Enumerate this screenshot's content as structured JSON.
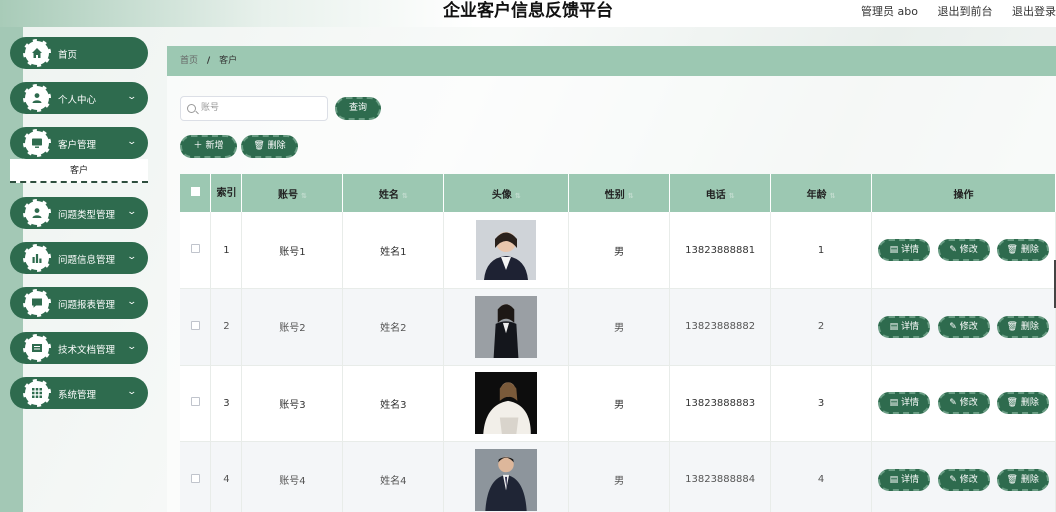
{
  "header": {
    "title": "企业客户信息反馈平台",
    "user_info": "管理员 abo",
    "exit_backend": "退出到前台",
    "logout": "退出登录"
  },
  "sidebar": {
    "items": [
      {
        "label": "首页",
        "icon": "home-icon",
        "has_arrow": false
      },
      {
        "label": "个人中心",
        "icon": "user-icon",
        "has_arrow": true
      },
      {
        "label": "客户管理",
        "icon": "monitor-icon",
        "has_arrow": true
      },
      {
        "label": "问题类型管理",
        "icon": "user-icon",
        "has_arrow": true
      },
      {
        "label": "问题信息管理",
        "icon": "chart-icon",
        "has_arrow": true
      },
      {
        "label": "问题报表管理",
        "icon": "chat-icon",
        "has_arrow": true
      },
      {
        "label": "技术文档管理",
        "icon": "doc-icon",
        "has_arrow": true
      },
      {
        "label": "系统管理",
        "icon": "grid-icon",
        "has_arrow": true
      }
    ],
    "submenu": {
      "label": "客户"
    }
  },
  "breadcrumb": {
    "home": "首页",
    "separator": "/",
    "current": "客户"
  },
  "search": {
    "placeholder": "账号",
    "button": "查询"
  },
  "actions": {
    "add": "新增",
    "delete": "删除"
  },
  "table": {
    "headers": [
      "索引",
      "账号",
      "姓名",
      "头像",
      "性别",
      "电话",
      "年龄",
      "操作"
    ],
    "rows": [
      {
        "index": "1",
        "account": "账号1",
        "name": "姓名1",
        "gender": "男",
        "phone": "13823888881",
        "age": "1"
      },
      {
        "index": "2",
        "account": "账号2",
        "name": "姓名2",
        "gender": "男",
        "phone": "13823888882",
        "age": "2"
      },
      {
        "index": "3",
        "account": "账号3",
        "name": "姓名3",
        "gender": "男",
        "phone": "13823888883",
        "age": "3"
      },
      {
        "index": "4",
        "account": "账号4",
        "name": "姓名4",
        "gender": "男",
        "phone": "13823888884",
        "age": "4"
      }
    ],
    "row_actions": {
      "detail": "详情",
      "edit": "修改",
      "delete": "删除"
    }
  },
  "colors": {
    "primary": "#2e6b4e",
    "header_green": "#9cc8b2",
    "strip": "#a3c8b5"
  }
}
